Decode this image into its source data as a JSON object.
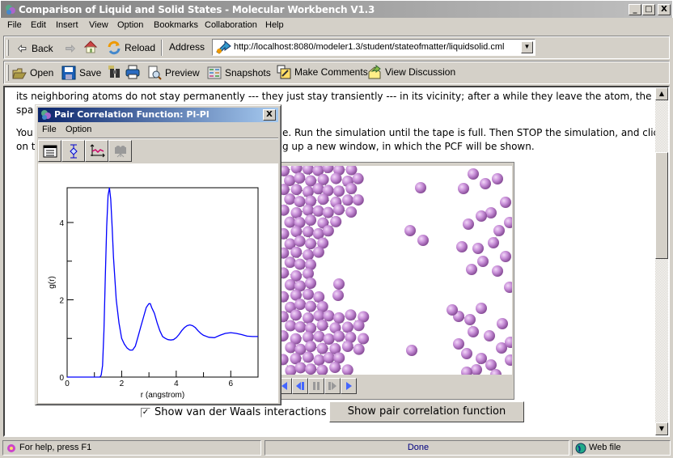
{
  "window": {
    "title": "Comparison of Liquid and Solid States - Molecular Workbench V1.3",
    "controls": [
      "_",
      "□",
      "X"
    ]
  },
  "menubar": [
    "File",
    "Edit",
    "Insert",
    "View",
    "Option",
    "Bookmarks",
    "Collaboration",
    "Help"
  ],
  "nav_toolbar": {
    "back": "Back",
    "reload": "Reload",
    "address_label": "Address",
    "address_value": "http://localhost:8080/modeler1.3/student/stateofmatter/liquidsolid.cml"
  },
  "file_toolbar": {
    "open": "Open",
    "save": "Save",
    "preview": "Preview",
    "snapshots": "Snapshots",
    "make_comments": "Make Comments",
    "view_discussion": "View Discussion"
  },
  "content": {
    "lines": [
      "its neighboring atoms do not stay permanently --- they just stay transiently --- in its vicinity; after a while they leave the atom, the",
      "spa",
      "You",
      "on t"
    ],
    "lines_right": [
      "e. Run the simulation until the tape is full. Then STOP the simulation, and click",
      "g up a new window, in which the PCF will be shown."
    ],
    "checkbox_label": "Show van der Waals interactions",
    "checkbox_checked": true,
    "pcf_button": "Show pair correlation function"
  },
  "dialog": {
    "title": "Pair Correlation Function: Pl-Pl",
    "menu": [
      "File",
      "Option"
    ]
  },
  "chart_data": {
    "type": "line",
    "title": "",
    "xlabel": "r (angstrom)",
    "ylabel": "g(r)",
    "xlim": [
      0,
      7
    ],
    "ylim": [
      0,
      4.9
    ],
    "xticks": [
      0,
      2,
      4,
      6
    ],
    "xminor": [
      1,
      3,
      5
    ],
    "yticks": [
      0,
      2,
      4
    ],
    "yminor": [
      1,
      3
    ],
    "grid": false,
    "series": [
      {
        "name": "Pl-Pl",
        "color": "#0000ff",
        "x": [
          0,
          1.2,
          1.25,
          1.3,
          1.35,
          1.4,
          1.45,
          1.5,
          1.55,
          1.6,
          1.65,
          1.7,
          1.8,
          1.9,
          2.0,
          2.1,
          2.2,
          2.3,
          2.4,
          2.5,
          2.6,
          2.7,
          2.8,
          2.9,
          3.0,
          3.05,
          3.1,
          3.2,
          3.3,
          3.4,
          3.5,
          3.6,
          3.7,
          3.8,
          3.9,
          4.0,
          4.1,
          4.2,
          4.3,
          4.4,
          4.5,
          4.6,
          4.7,
          4.8,
          4.9,
          5.0,
          5.2,
          5.4,
          5.6,
          5.8,
          6.0,
          6.2,
          6.4,
          6.6,
          6.8,
          7.0
        ],
        "y": [
          0,
          0,
          0.05,
          0.3,
          1.2,
          2.6,
          3.9,
          4.7,
          4.9,
          4.6,
          3.9,
          3.1,
          2.0,
          1.4,
          1.0,
          0.85,
          0.75,
          0.7,
          0.7,
          0.8,
          1.05,
          1.3,
          1.55,
          1.8,
          1.9,
          1.9,
          1.8,
          1.65,
          1.4,
          1.2,
          1.05,
          1.0,
          0.97,
          0.96,
          0.97,
          1.02,
          1.1,
          1.2,
          1.28,
          1.33,
          1.35,
          1.33,
          1.28,
          1.2,
          1.13,
          1.08,
          1.03,
          1.02,
          1.08,
          1.13,
          1.15,
          1.13,
          1.1,
          1.06,
          1.05,
          1.05
        ]
      }
    ]
  },
  "statusbar": {
    "help": "For help, press F1",
    "status": "Done",
    "zone": "Web file"
  },
  "colors": {
    "atom": "#c88fd8",
    "dialog_title_start": "#0a246a",
    "dialog_title_end": "#a6caf0",
    "curve": "#0000ff",
    "status_done": "#000080"
  }
}
